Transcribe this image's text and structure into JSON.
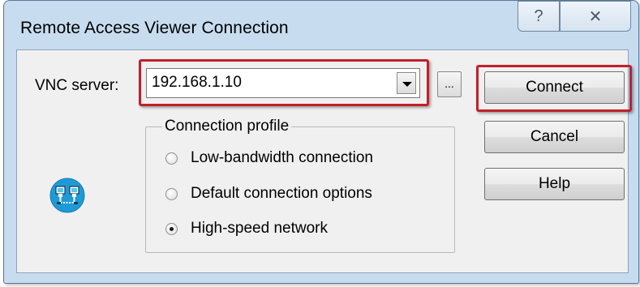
{
  "window": {
    "title": "Remote Access Viewer Connection",
    "help_glyph": "?",
    "close_glyph": "✕"
  },
  "server": {
    "label": "VNC server:",
    "value": "192.168.1.10",
    "browse_label": "..."
  },
  "buttons": {
    "connect": "Connect",
    "cancel": "Cancel",
    "help": "Help"
  },
  "profile": {
    "title": "Connection profile",
    "options": [
      {
        "label": "Low-bandwidth connection",
        "selected": false
      },
      {
        "label": "Default connection options",
        "selected": false
      },
      {
        "label": "High-speed network",
        "selected": true
      }
    ]
  },
  "icons": {
    "network": "network-computers-icon",
    "help": "help-icon",
    "close": "close-icon",
    "dropdown": "chevron-down-icon"
  },
  "colors": {
    "titlebar": "#c7dcef",
    "highlight": "#c0202a",
    "icon_blue": "#1f9ad6"
  }
}
